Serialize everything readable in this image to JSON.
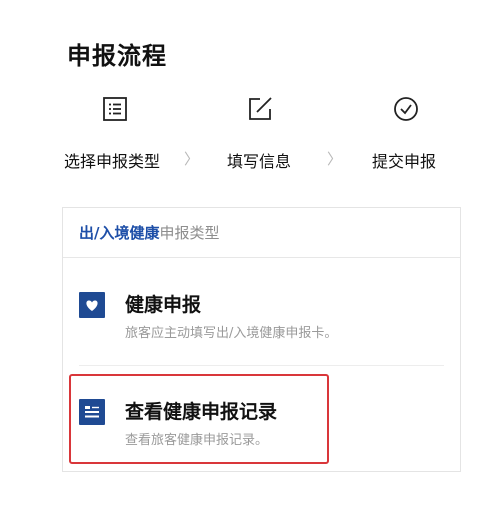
{
  "page": {
    "title": "申报流程"
  },
  "steps": [
    {
      "label": "选择申报类型",
      "icon": "list-icon"
    },
    {
      "label": "填写信息",
      "icon": "edit-icon"
    },
    {
      "label": "提交申报",
      "icon": "check-circle-icon"
    }
  ],
  "step_separator": "〉",
  "card": {
    "header_highlight": "出/入境健康",
    "header_rest": "申报类型",
    "items": [
      {
        "title": "健康申报",
        "desc": "旅客应主动填写出/入境健康申报卡。",
        "icon": "heart-icon"
      },
      {
        "title": "查看健康申报记录",
        "desc": "查看旅客健康申报记录。",
        "icon": "records-icon"
      }
    ]
  },
  "colors": {
    "accent": "#1e4fa8",
    "icon_bg": "#1f4a93",
    "highlight_border": "#d9363a"
  }
}
